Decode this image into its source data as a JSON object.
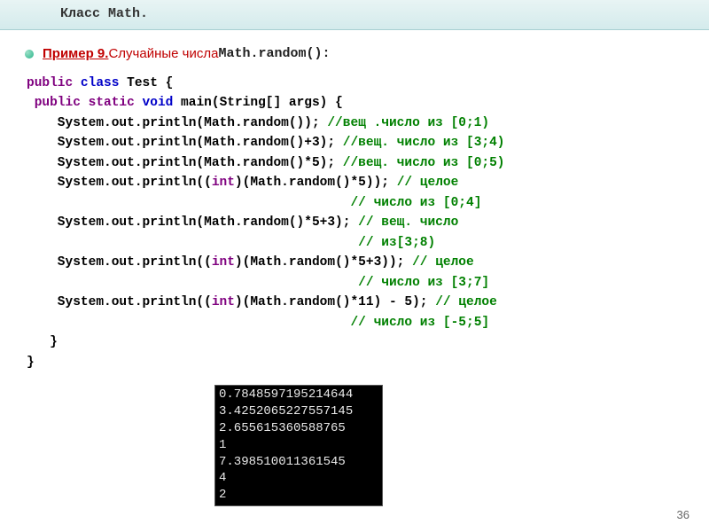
{
  "header": {
    "title": "Класс Math."
  },
  "example": {
    "label": "Пример 9. ",
    "text": "Случайные числа ",
    "code": "Math.random():"
  },
  "code": {
    "l1a": "public",
    "l1b": " class",
    "l1c": " Test {",
    "l2a": " public",
    "l2b": " static",
    "l2c": " void",
    "l2d": " main(String[] args) {",
    "l3a": "    System.out.println(Math.random()); ",
    "l3b": "//вещ .число из [0;1)",
    "l4a": "    System.out.println(Math.random()+3); ",
    "l4b": "//вещ. число из [3;4)",
    "l5a": "    System.out.println(Math.random()*5); ",
    "l5b": "//вещ. число из [0;5)",
    "l6a": "    System.out.println((",
    "l6b": "int",
    "l6c": ")(Math.random()*5)); ",
    "l6d": "// целое",
    "l7a": "                                          ",
    "l7b": "// число из [0;4]",
    "l8a": "    System.out.println(Math.random()*5+3); ",
    "l8b": "// вещ. число",
    "l9a": "                                           ",
    "l9b": "// из[3;8)",
    "l10a": "    System.out.println((",
    "l10b": "int",
    "l10c": ")(Math.random()*5+3)); ",
    "l10d": "// целое",
    "l11a": "                                           ",
    "l11b": "// число из [3;7]",
    "l12a": "    System.out.println((",
    "l12b": "int",
    "l12c": ")(Math.random()*11) - 5); ",
    "l12d": "// целое",
    "l13a": "                                          ",
    "l13b": "// число из [-5;5]",
    "l14": "   }",
    "l15": "}"
  },
  "console": {
    "l1": "0.7848597195214644",
    "l2": "3.4252065227557145",
    "l3": "2.655615360588765",
    "l4": "1",
    "l5": "7.398510011361545",
    "l6": "4",
    "l7": "2"
  },
  "page": {
    "number": "36"
  }
}
